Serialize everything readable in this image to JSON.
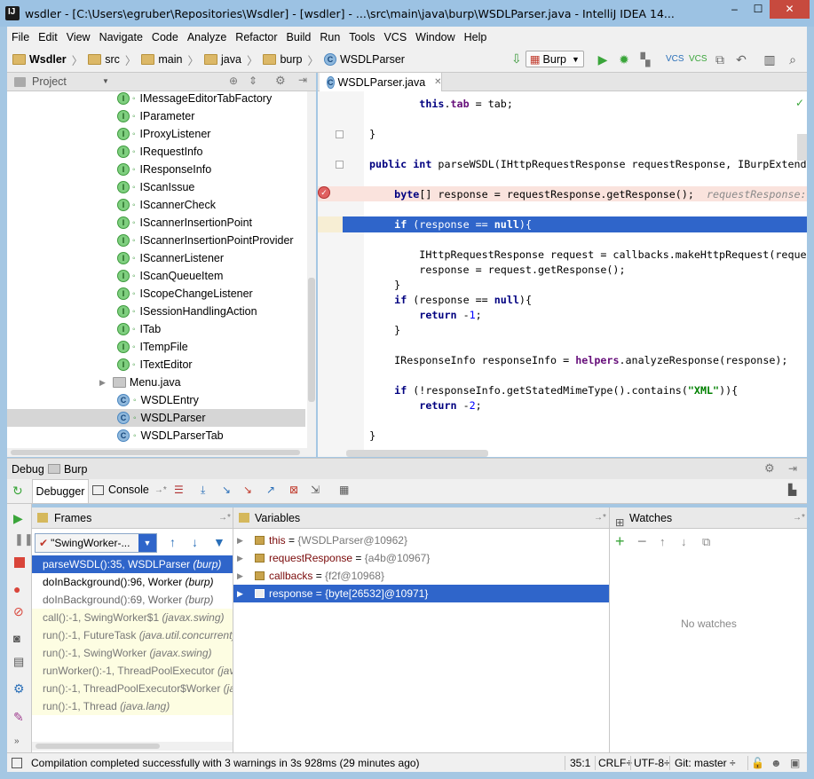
{
  "window": {
    "title": "wsdler - [C:\\Users\\egruber\\Repositories\\Wsdler] - [wsdler] - ...\\src\\main\\java\\burp\\WSDLParser.java - IntelliJ IDEA 14...",
    "minimize": "‒",
    "maximize": "☐",
    "close": "✕"
  },
  "menu": [
    "File",
    "Edit",
    "View",
    "Navigate",
    "Code",
    "Analyze",
    "Refactor",
    "Build",
    "Run",
    "Tools",
    "VCS",
    "Window",
    "Help"
  ],
  "breadcrumbs": [
    "Wsdler",
    "src",
    "main",
    "java",
    "burp",
    "WSDLParser"
  ],
  "run_config": "Burp",
  "project_panel": {
    "title": "Project",
    "items": [
      {
        "name": "IMessageEditorTabFactory",
        "type": "I"
      },
      {
        "name": "IParameter",
        "type": "I"
      },
      {
        "name": "IProxyListener",
        "type": "I"
      },
      {
        "name": "IRequestInfo",
        "type": "I"
      },
      {
        "name": "IResponseInfo",
        "type": "I"
      },
      {
        "name": "IScanIssue",
        "type": "I"
      },
      {
        "name": "IScannerCheck",
        "type": "I"
      },
      {
        "name": "IScannerInsertionPoint",
        "type": "I"
      },
      {
        "name": "IScannerInsertionPointProvider",
        "type": "I"
      },
      {
        "name": "IScannerListener",
        "type": "I"
      },
      {
        "name": "IScanQueueItem",
        "type": "I"
      },
      {
        "name": "IScopeChangeListener",
        "type": "I"
      },
      {
        "name": "ISessionHandlingAction",
        "type": "I"
      },
      {
        "name": "ITab",
        "type": "I"
      },
      {
        "name": "ITempFile",
        "type": "I"
      },
      {
        "name": "ITextEditor",
        "type": "I"
      },
      {
        "name": "Menu.java",
        "type": "folder"
      },
      {
        "name": "WSDLEntry",
        "type": "C"
      },
      {
        "name": "WSDLParser",
        "type": "C"
      },
      {
        "name": "WSDLParserTab",
        "type": "C"
      }
    ]
  },
  "editor": {
    "tab": "WSDLParser.java",
    "lines": [
      [
        [
          "        ",
          ""
        ],
        [
          "this",
          ".kw"
        ],
        [
          ".",
          ""
        ],
        [
          "tab",
          ".fld"
        ],
        [
          " = tab;",
          ""
        ]
      ],
      [
        [
          "",
          ""
        ]
      ],
      [
        [
          "    }",
          ""
        ]
      ],
      [
        [
          "",
          ""
        ]
      ],
      [
        [
          "public int",
          ".kw"
        ],
        [
          " parseWSDL(IHttpRequestResponse requestResponse, IBurpExtender",
          ""
        ]
      ],
      [
        [
          "",
          ""
        ]
      ],
      [
        [
          "    ",
          ""
        ],
        [
          "byte",
          ".kw"
        ],
        [
          "[] response = requestResponse.getResponse();  ",
          ""
        ],
        [
          "requestResponse: ",
          ".hint"
        ]
      ],
      [
        [
          "",
          ""
        ]
      ],
      [
        [
          "    ",
          ""
        ],
        [
          "if",
          ".kw"
        ],
        [
          " (response == ",
          ""
        ],
        [
          "null",
          ".kw"
        ],
        [
          "){",
          ""
        ]
      ],
      [
        [
          "",
          ""
        ]
      ],
      [
        [
          "        IHttpRequestResponse request = callbacks.makeHttpRequest(reques",
          ""
        ]
      ],
      [
        [
          "        response = request.getResponse();",
          ""
        ]
      ],
      [
        [
          "    }",
          ""
        ]
      ],
      [
        [
          "    ",
          ""
        ],
        [
          "if",
          ".kw"
        ],
        [
          " (response == ",
          ""
        ],
        [
          "null",
          ".kw"
        ],
        [
          "){",
          ""
        ]
      ],
      [
        [
          "        ",
          ""
        ],
        [
          "return",
          ".kw"
        ],
        [
          " -",
          ""
        ],
        [
          "1",
          ".num"
        ],
        [
          ";",
          ""
        ]
      ],
      [
        [
          "    }",
          ""
        ]
      ],
      [
        [
          "",
          ""
        ]
      ],
      [
        [
          "    IResponseInfo responseInfo = ",
          ""
        ],
        [
          "helpers",
          ".fld"
        ],
        [
          ".analyzeResponse(response);",
          ""
        ]
      ],
      [
        [
          "",
          ""
        ]
      ],
      [
        [
          "    ",
          ""
        ],
        [
          "if",
          ".kw"
        ],
        [
          " (!responseInfo.getStatedMimeType().contains(",
          ""
        ],
        [
          "\"XML\"",
          ".str"
        ],
        [
          ")){",
          ""
        ]
      ],
      [
        [
          "        ",
          ""
        ],
        [
          "return",
          ".kw"
        ],
        [
          " -",
          ""
        ],
        [
          "2",
          ".num"
        ],
        [
          ";",
          ""
        ]
      ],
      [
        [
          "",
          ""
        ]
      ],
      [
        [
          "    }",
          ""
        ]
      ]
    ]
  },
  "debug": {
    "title": "Debug",
    "config": "Burp",
    "tabs": {
      "debugger": "Debugger",
      "console": "Console"
    },
    "frames_title": "Frames",
    "thread": "\"SwingWorker-...",
    "frames": [
      {
        "method": "parseWSDL():35, WSDLParser",
        "pkg": "(burp)",
        "state": "selected"
      },
      {
        "method": "doInBackground():96, Worker",
        "pkg": "(burp)",
        "state": "normal"
      },
      {
        "method": "doInBackground():69, Worker",
        "pkg": "(burp)",
        "state": "dim"
      },
      {
        "method": "call():-1, SwingWorker$1",
        "pkg": "(javax.swing)",
        "state": "lib"
      },
      {
        "method": "run():-1, FutureTask",
        "pkg": "(java.util.concurrent)",
        "state": "lib"
      },
      {
        "method": "run():-1, SwingWorker",
        "pkg": "(javax.swing)",
        "state": "lib"
      },
      {
        "method": "runWorker():-1, ThreadPoolExecutor",
        "pkg": "(java.util.concurrent)",
        "state": "lib"
      },
      {
        "method": "run():-1, ThreadPoolExecutor$Worker",
        "pkg": "(java.util.concurrent)",
        "state": "lib"
      },
      {
        "method": "run():-1, Thread",
        "pkg": "(java.lang)",
        "state": "lib"
      }
    ],
    "variables_title": "Variables",
    "variables": [
      {
        "name": "this",
        "value": "{WSDLParser@10962}",
        "selected": false
      },
      {
        "name": "requestResponse",
        "value": "{a4b@10967}",
        "selected": false
      },
      {
        "name": "callbacks",
        "value": "{f2f@10968}",
        "selected": false
      },
      {
        "name": "response",
        "value": "{byte[26532]@10971}",
        "selected": true
      }
    ],
    "watches_title": "Watches",
    "no_watches": "No watches"
  },
  "status": {
    "message": "Compilation completed successfully with 3 warnings in 3s 928ms (29 minutes ago)",
    "position": "35:1",
    "line_sep": "CRLF÷",
    "encoding": "UTF-8÷",
    "vcs": "Git: master ÷"
  },
  "colors": {
    "selection": "#2f65ca",
    "breakpoint_line": "#fae3dd",
    "lib_frame": "#fdfde2"
  }
}
